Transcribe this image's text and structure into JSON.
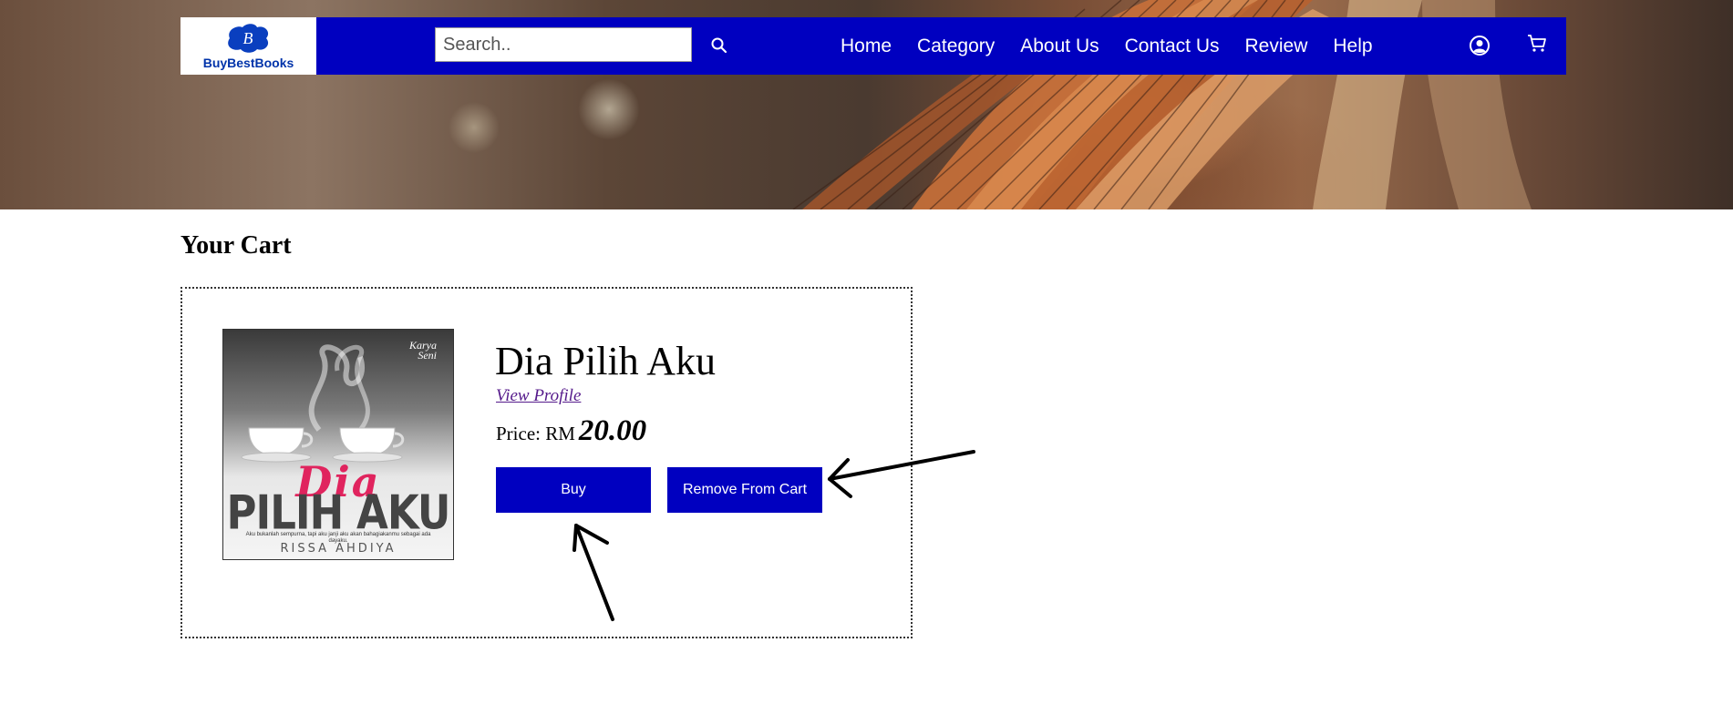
{
  "logo": {
    "text": "BuyBestBooks"
  },
  "search": {
    "placeholder": "Search.."
  },
  "nav": {
    "links": [
      "Home",
      "Category",
      "About Us",
      "Contact Us",
      "Review",
      "Help"
    ]
  },
  "icons": {
    "search": "search-icon",
    "account": "user-circle-icon",
    "cart": "shopping-cart-icon"
  },
  "colors": {
    "navbar": "#0000c0",
    "button": "#0000c0",
    "link_visited": "#551a8b"
  },
  "cart": {
    "title": "Your Cart",
    "item": {
      "title": "Dia Pilih Aku",
      "profile_link": "View Profile",
      "price_label": "Price: RM",
      "price_value": "20.00",
      "cover": {
        "publisher_line1": "Karya",
        "publisher_line2": "Seni",
        "title_script": "Dia",
        "title_main": "PILIH AKU",
        "tagline": "Aku bukanlah sempurna, tapi aku janji aku akan bahagiakanmu sebagai ada dayaku.",
        "author": "RISSA AHDIYA"
      }
    },
    "buy_label": "Buy",
    "remove_label": "Remove From Cart"
  }
}
